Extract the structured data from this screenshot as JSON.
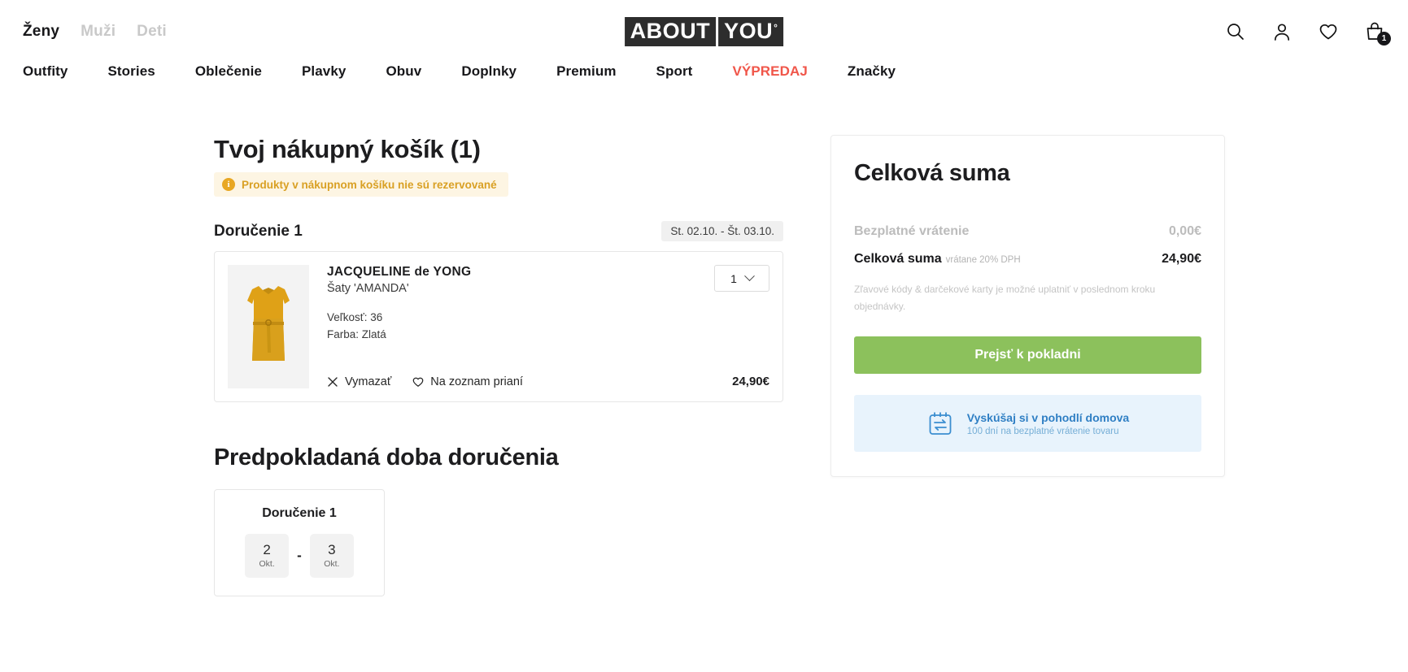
{
  "header": {
    "gender_nav": [
      {
        "label": "Ženy",
        "active": true
      },
      {
        "label": "Muži",
        "active": false
      },
      {
        "label": "Deti",
        "active": false
      }
    ],
    "logo": {
      "part1": "ABOUT",
      "part2": "YOU",
      "degree": "°"
    },
    "icons": [
      {
        "name": "search-icon",
        "label": "search"
      },
      {
        "name": "account-icon",
        "label": "account"
      },
      {
        "name": "wishlist-heart-icon",
        "label": "wishlist"
      },
      {
        "name": "shopping-bag-icon",
        "label": "bag",
        "badge": "1"
      }
    ],
    "main_nav": [
      {
        "label": "Outfity",
        "sale": false
      },
      {
        "label": "Stories",
        "sale": false
      },
      {
        "label": "Oblečenie",
        "sale": false
      },
      {
        "label": "Plavky",
        "sale": false
      },
      {
        "label": "Obuv",
        "sale": false
      },
      {
        "label": "Doplnky",
        "sale": false
      },
      {
        "label": "Premium",
        "sale": false
      },
      {
        "label": "Sport",
        "sale": false
      },
      {
        "label": "VÝPREDAJ",
        "sale": true
      },
      {
        "label": "Značky",
        "sale": false
      }
    ]
  },
  "cart": {
    "title": "Tvoj nákupný košík (1)",
    "warning": "Produkty v nákupnom košíku nie sú rezervované",
    "delivery_label": "Doručenie 1",
    "delivery_date_range": "St. 02.10. - Št. 03.10.",
    "item": {
      "brand": "JACQUELINE de YONG",
      "name": "Šaty 'AMANDA'",
      "size": "Veľkosť: 36",
      "color": "Farba: Zlatá",
      "quantity": "1",
      "price": "24,90€",
      "delete_label": "Vymazať",
      "wishlist_label": "Na zoznam prianí"
    }
  },
  "eta": {
    "title": "Predpokladaná doba doručenia",
    "card_title": "Doručenie 1",
    "start_day": "2",
    "start_month": "Okt.",
    "separator": "-",
    "end_day": "3",
    "end_month": "Okt."
  },
  "summary": {
    "title": "Celková suma",
    "free_return_label": "Bezplatné vrátenie",
    "free_return_value": "0,00€",
    "total_label": "Celková suma",
    "total_vat": "vrátane 20% DPH",
    "total_value": "24,90€",
    "note": "Zľavové kódy & darčekové karty je možné uplatniť v poslednom kroku objednávky.",
    "checkout_label": "Prejsť k pokladni",
    "info_title": "Vyskúšaj si v pohodlí domova",
    "info_subtitle": "100 dní na bezplatné vrátenie tovaru"
  },
  "colors": {
    "sale": "#f0564a",
    "checkout": "#8cc15c",
    "info_blue": "#2f7fc4",
    "warning": "#d9a024"
  }
}
